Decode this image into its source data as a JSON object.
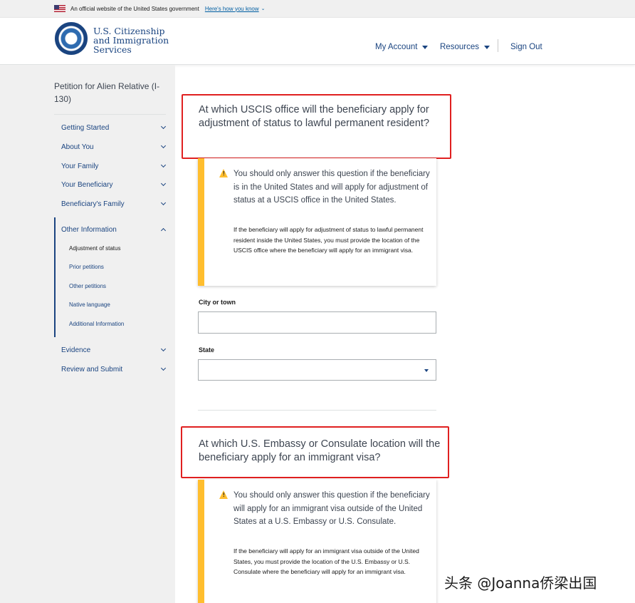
{
  "gov_banner": {
    "text": "An official website of the United States government",
    "link": "Here's how you know"
  },
  "header": {
    "agency_line1": "U.S. Citizenship",
    "agency_line2": "and Immigration",
    "agency_line3": "Services",
    "nav": {
      "my_account": "My Account",
      "resources": "Resources",
      "sign_out": "Sign Out"
    }
  },
  "sidebar": {
    "title": "Petition for Alien Relative (I-130)",
    "sections_top": [
      {
        "label": "Getting Started"
      },
      {
        "label": "About You"
      },
      {
        "label": "Your Family"
      },
      {
        "label": "Your Beneficiary"
      },
      {
        "label": "Beneficiary's Family"
      }
    ],
    "active_section": {
      "label": "Other Information",
      "subitems": [
        {
          "label": "Adjustment of status"
        },
        {
          "label": "Prior petitions"
        },
        {
          "label": "Other petitions"
        },
        {
          "label": "Native language"
        },
        {
          "label": "Additional Information"
        }
      ]
    },
    "sections_bottom": [
      {
        "label": "Evidence"
      },
      {
        "label": "Review and Submit"
      }
    ]
  },
  "question1": {
    "text": "At which USCIS office will the beneficiary apply for adjustment of status to lawful permanent resident?",
    "alert_main": "You should only answer this question if the beneficiary is in the United States and will apply for adjustment of status at a USCIS office in the United States.",
    "alert_sub": "If the beneficiary will apply for adjustment of status to lawful permanent resident inside the United States, you must provide the location of the USCIS office where the beneficiary will apply for an immigrant visa.",
    "city_label": "City or town",
    "city_value": "",
    "state_label": "State",
    "state_value": ""
  },
  "question2": {
    "text": "At which U.S. Embassy or Consulate location will the beneficiary apply for an immigrant visa?",
    "alert_main": "You should only answer this question if the beneficiary will apply for an immigrant visa outside of the United States at a U.S. Embassy or U.S. Consulate.",
    "alert_sub": "If the beneficiary will apply for an immigrant visa outside of the United States, you must provide the location of the U.S. Embassy or U.S. Consulate where the beneficiary will apply for an immigrant visa."
  },
  "watermark": "头条 @Joanna侨梁出国",
  "icons": {
    "flag": "us-flag-icon",
    "seal": "dhs-seal-icon",
    "warning": "warning-triangle-icon"
  },
  "colors": {
    "primary": "#1a4480",
    "link": "#005ea2",
    "warning": "#ffbe2e",
    "highlight": "#e02020",
    "sidebar_bg": "#f0f0f0"
  }
}
